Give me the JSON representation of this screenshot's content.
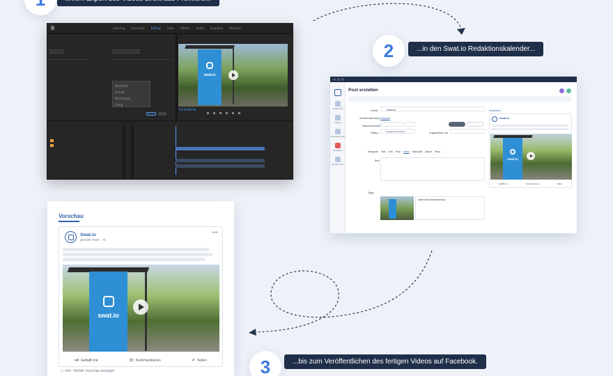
{
  "steps": [
    {
      "number": "1",
      "caption": "...vom Export des Videos direkt aus Premiere..."
    },
    {
      "number": "2",
      "caption": "...in den Swat.io Redaktionskalender..."
    },
    {
      "number": "3",
      "caption": "...bis zum Veröffentlichen des fertigen Videos auf Facebook."
    }
  ],
  "premiere": {
    "menu": [
      "Learning",
      "Assembly",
      "Editing",
      "Color",
      "Effects",
      "Audio",
      "Graphics",
      "Libraries"
    ],
    "active_menu": "Editing",
    "timecode": "00:00:00:00",
    "menu_options": [
      "Standard",
      "Einheit",
      "Hinzufügen",
      "Fertig"
    ]
  },
  "swatio": {
    "title": "Post erstellen",
    "sidebar": [
      "Dashboard",
      "Tickets",
      "Redaktionsplan",
      "Statistiken",
      "Einstellungen"
    ],
    "fields": {
      "kanal_label": "Kanal",
      "kanal_value": "Swat.io",
      "veroeff_label": "Veröffentlichung",
      "veroeff_value": "Geplant",
      "datum_label": "Datum/Uhrzeit",
      "status_label": "Status",
      "status_value": "Freigabe erforderlich",
      "zugewiesen_label": "Zugewiesen an",
      "text_label": "Text",
      "tags_label": "Tags",
      "alt_text": "Alternative Beschreibung"
    },
    "tabs": [
      "Kategorie",
      "Text",
      "Link",
      "Foto",
      "Video",
      "Karussell",
      "Album",
      "Story"
    ],
    "preview_label": "Vorschau",
    "preview_name": "Swat.io",
    "preview_actions": [
      "Gefällt mir",
      "Kommentieren",
      "Teilen"
    ]
  },
  "facebook": {
    "heading": "Vorschau",
    "page_name": "Swat.io",
    "subtitle": "gerade eben · ⚙",
    "actions": [
      "Gefällt mir",
      "Kommentieren",
      "Teilen"
    ],
    "info": "ⓘ Info · Mobile Vorschau anzeigen",
    "banner_text": "swat.io"
  }
}
